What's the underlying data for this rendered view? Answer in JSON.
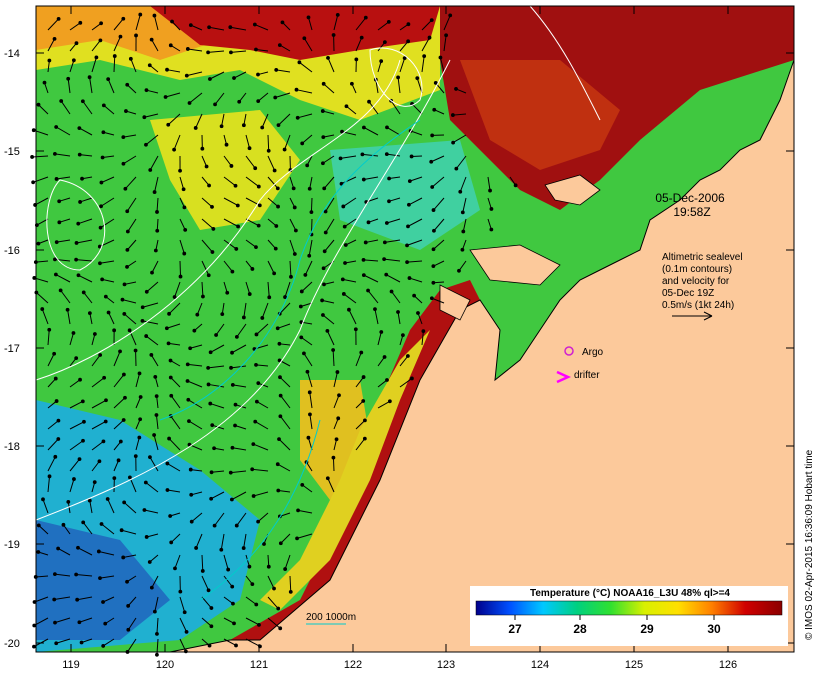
{
  "map": {
    "lat_ticks": [
      "-14",
      "-15",
      "-16",
      "-17",
      "-18",
      "-19",
      "-20"
    ],
    "lon_ticks": [
      "119",
      "120",
      "121",
      "122",
      "123",
      "124",
      "125",
      "126"
    ],
    "land_color": "#fcc99b",
    "coast_color": "#000000"
  },
  "annotations": {
    "date": "05-Dec-2006",
    "time": "19:58Z",
    "altimetry_lines": [
      "Altimetric sealevel",
      "(0.1m contours)",
      "and velocity for",
      "05-Dec 19Z",
      "0.5m/s (1kt 24h)"
    ],
    "argo_label": "Argo",
    "drifter_label": "drifter",
    "argo_color": "#d020d0",
    "drifter_color": "#ff00ff",
    "isobath_label": "200  1000m",
    "isobath_color": "#00cccc"
  },
  "colorbar": {
    "title": "Temperature (°C) NOAA16_L3U 48% ql>=4",
    "ticks": [
      "27",
      "28",
      "29",
      "30"
    ],
    "min": 26.0,
    "max": 31.0,
    "stops": [
      "#00008b",
      "#0050ff",
      "#00c8ff",
      "#00d080",
      "#30e030",
      "#d8f000",
      "#ffe000",
      "#ff8000",
      "#d00000",
      "#8b0000"
    ]
  },
  "credit": "© IMOS 02-Apr-2015 16:36:09 Hobart time"
}
